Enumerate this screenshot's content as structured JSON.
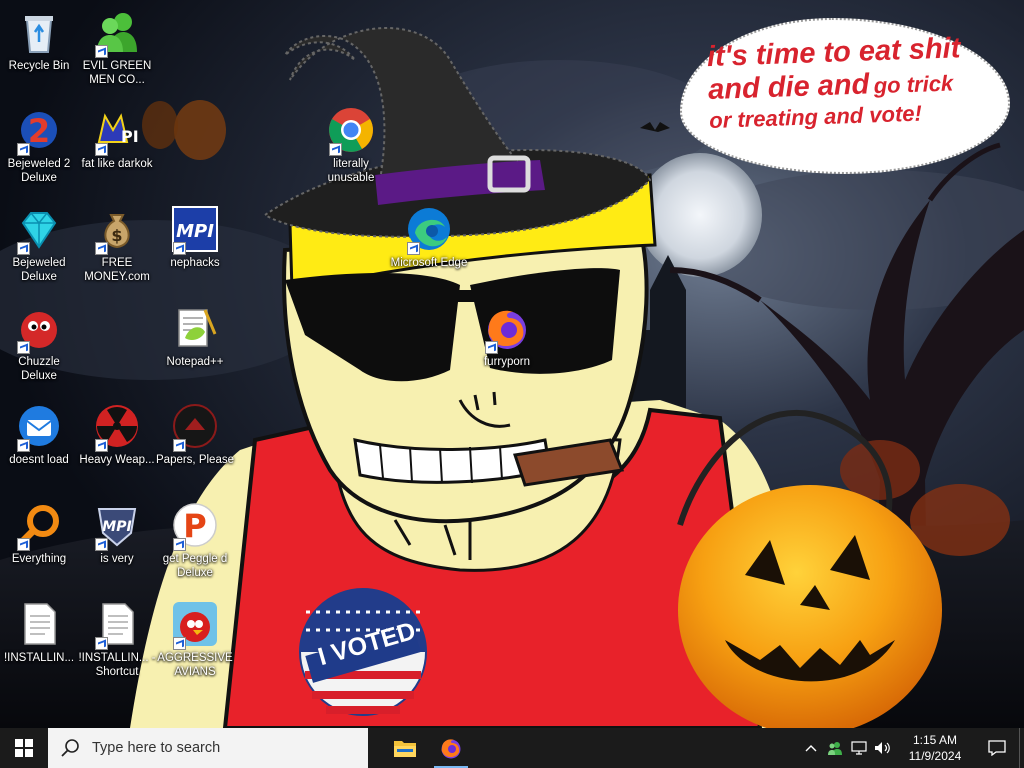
{
  "wallpaper": {
    "speech_line1": "it's time to eat shit",
    "speech_line2a": "and die and",
    "speech_line2b": "go trick",
    "speech_line3": "or treating and vote!",
    "sticker_text": "I VOTED"
  },
  "desktop_icons": [
    {
      "label": "Recycle Bin",
      "icon": "recycle-bin-icon"
    },
    {
      "label": "EVIL GREEN MEN CO...",
      "icon": "green-men-icon"
    },
    {
      "label": "Bejeweled 2 Deluxe",
      "icon": "bejeweled2-icon"
    },
    {
      "label": "fat like darkok",
      "icon": "mpi-logo-icon"
    },
    {
      "label": "literally unusable",
      "icon": "chrome-icon"
    },
    {
      "label": "Bejeweled Deluxe",
      "icon": "diamond-icon"
    },
    {
      "label": "FREE MONEY.com",
      "icon": "money-bag-icon"
    },
    {
      "label": "nephacks",
      "icon": "mpi-blue-icon"
    },
    {
      "label": "Microsoft Edge",
      "icon": "edge-icon"
    },
    {
      "label": "Chuzzle Deluxe",
      "icon": "chuzzle-icon"
    },
    {
      "label": "Notepad++",
      "icon": "notepadpp-icon"
    },
    {
      "label": "furryporn",
      "icon": "firefox-icon"
    },
    {
      "label": "doesnt load",
      "icon": "thunderbird-icon"
    },
    {
      "label": "Heavy Weap...",
      "icon": "radiation-icon"
    },
    {
      "label": "Papers, Please",
      "icon": "papers-please-icon"
    },
    {
      "label": "Everything",
      "icon": "everything-search-icon"
    },
    {
      "label": "is very",
      "icon": "mpi-shield-icon"
    },
    {
      "label": "get Peggle d Deluxe",
      "icon": "peggle-icon"
    },
    {
      "label": "!INSTALLIN...",
      "icon": "text-file-icon"
    },
    {
      "label": "!INSTALLIN... - Shortcut",
      "icon": "text-file-icon"
    },
    {
      "label": "AGGRESSIVE AVIANS",
      "icon": "angry-bird-icon"
    }
  ],
  "taskbar": {
    "search_placeholder": "Type here to search",
    "time": "1:15 AM",
    "date": "11/9/2024",
    "apps": [
      {
        "name": "File Explorer",
        "icon": "folder-icon"
      },
      {
        "name": "Firefox",
        "icon": "firefox-icon"
      }
    ]
  },
  "colors": {
    "taskbar": "#1b1b1b",
    "search_box": "#f3f3f3",
    "speech_text": "#d8232e",
    "taskbar_highlight": "#79b8f2"
  }
}
